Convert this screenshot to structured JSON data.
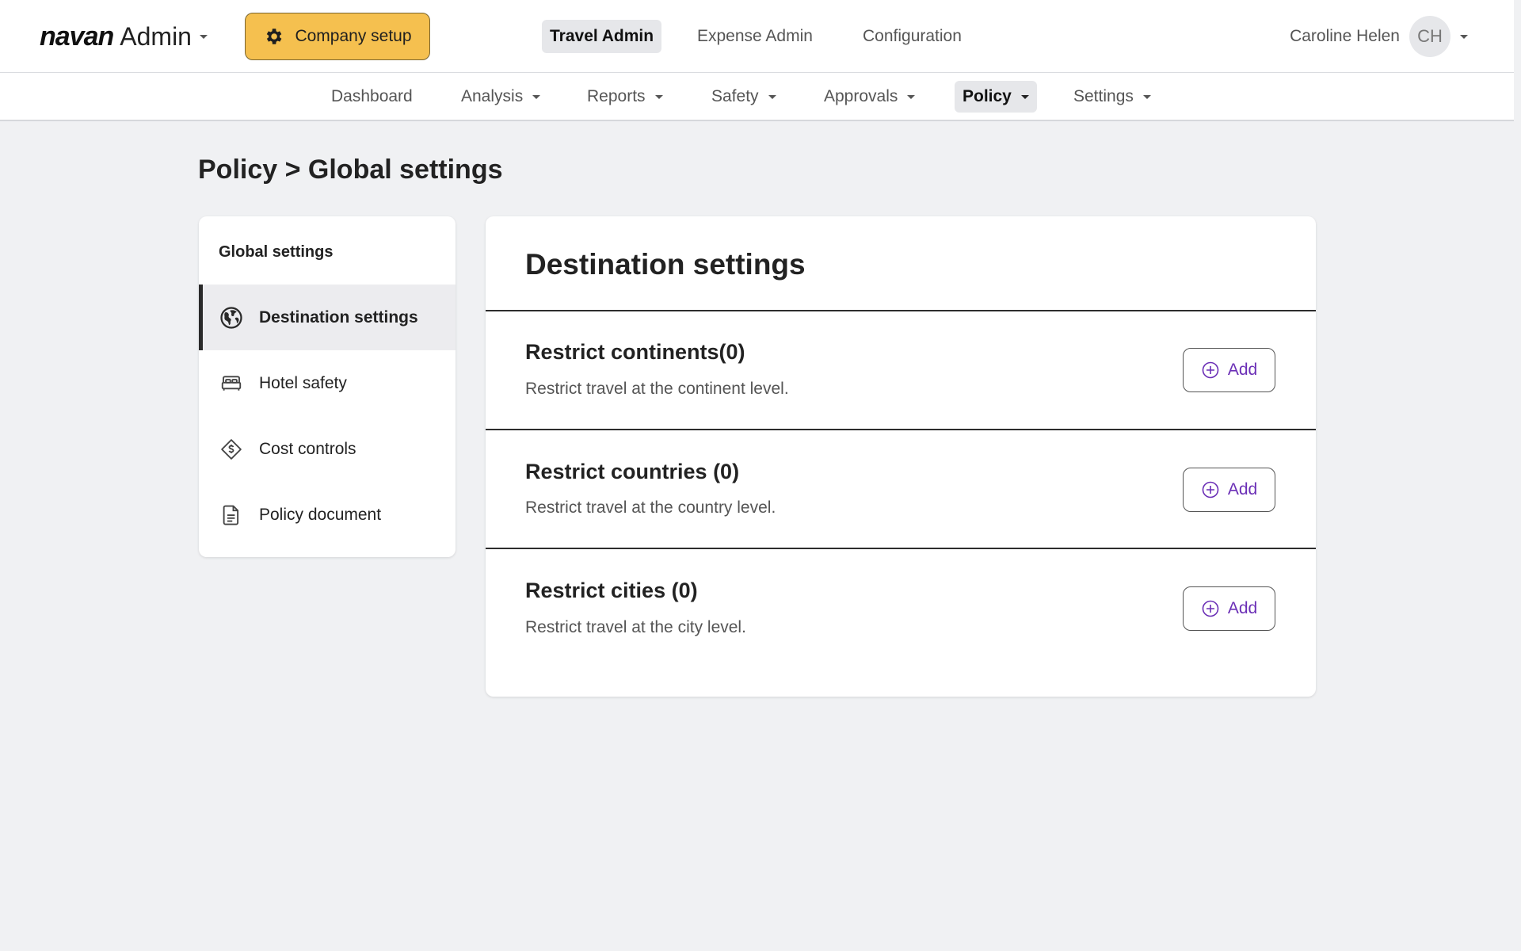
{
  "header": {
    "logo_word": "navan",
    "logo_suffix": "Admin",
    "company_setup_label": "Company setup",
    "top_nav": [
      {
        "label": "Travel Admin",
        "active": true
      },
      {
        "label": "Expense Admin",
        "active": false
      },
      {
        "label": "Configuration",
        "active": false
      }
    ],
    "user_name": "Caroline Helen",
    "user_initials": "CH"
  },
  "sub_nav": [
    {
      "label": "Dashboard",
      "dropdown": false
    },
    {
      "label": "Analysis",
      "dropdown": true
    },
    {
      "label": "Reports",
      "dropdown": true
    },
    {
      "label": "Safety",
      "dropdown": true
    },
    {
      "label": "Approvals",
      "dropdown": true
    },
    {
      "label": "Policy",
      "dropdown": true,
      "active": true
    },
    {
      "label": "Settings",
      "dropdown": true
    }
  ],
  "page": {
    "title": "Policy > Global settings"
  },
  "sidebar": {
    "heading": "Global settings",
    "items": [
      {
        "label": "Destination settings",
        "icon": "globe-icon",
        "active": true
      },
      {
        "label": "Hotel safety",
        "icon": "bed-icon"
      },
      {
        "label": "Cost controls",
        "icon": "dollar-tag-icon"
      },
      {
        "label": "Policy document",
        "icon": "document-icon"
      }
    ]
  },
  "main": {
    "title": "Destination settings",
    "sections": [
      {
        "title": "Restrict continents(0)",
        "description": "Restrict travel at the continent level.",
        "button_label": "Add"
      },
      {
        "title": "Restrict countries (0)",
        "description": "Restrict travel at the country level.",
        "button_label": "Add"
      },
      {
        "title": "Restrict cities (0)",
        "description": "Restrict travel at the city level.",
        "button_label": "Add"
      }
    ]
  },
  "colors": {
    "accent_yellow": "#f5c04f",
    "accent_purple": "#6b2fb6",
    "page_bg": "#f0f1f3"
  }
}
